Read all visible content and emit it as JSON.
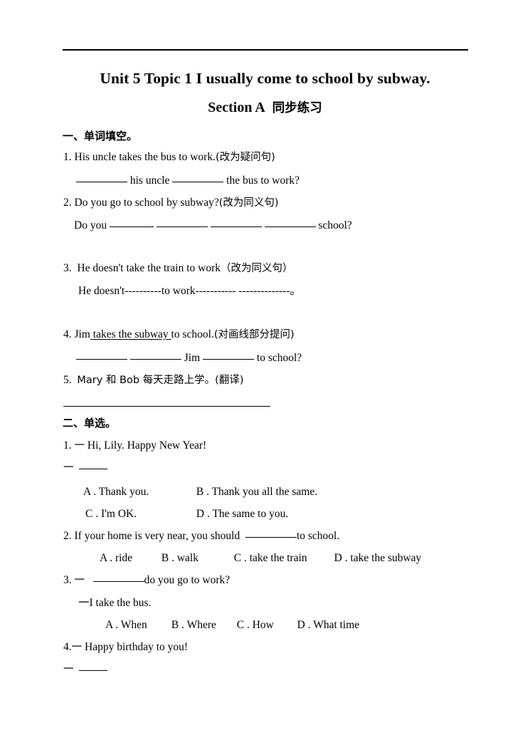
{
  "document": {
    "title": "Unit 5 Topic 1 I usually come to school by subway.",
    "subtitle_en": "Section A",
    "subtitle_cn": "同步练习"
  },
  "section_one": {
    "heading": "一、单词填空。",
    "questions": [
      {
        "number": "1.",
        "prompt": "His uncle takes the bus to work.",
        "instruction": "(改为疑问句)",
        "answer_pre": "",
        "answer_mid": "his uncle",
        "answer_post": "the bus to work?"
      },
      {
        "number": "2.",
        "prompt": "Do you go to school by subway?",
        "instruction": "(改为同义句)",
        "answer_pre": "Do you",
        "answer_post": "school?"
      },
      {
        "number": "3.",
        "prompt": "He doesn't take the train to work",
        "instruction": "（改为同义句）",
        "answer_text": "He doesn't----------to work-----------  --------------。"
      },
      {
        "number": "4.",
        "prompt_pre": "Jim",
        "prompt_underlined": " takes the subway ",
        "prompt_post": "to school.",
        "instruction": "(对画线部分提问)",
        "answer_mid": "Jim",
        "answer_post": "to school?"
      },
      {
        "number": "5.",
        "prompt": "Mary 和 Bob 每天走路上学。",
        "instruction": "(翻译)"
      }
    ]
  },
  "section_two": {
    "heading": "二、单选。",
    "questions": [
      {
        "number": "1.",
        "dash": "一",
        "stem": "Hi, Lily. Happy New Year!",
        "reply_dash": "一",
        "options": [
          {
            "letter": "A",
            "sep": ".",
            "text": "Thank you."
          },
          {
            "letter": "B",
            "sep": ".",
            "text": "Thank you all the same."
          },
          {
            "letter": "C",
            "sep": ".",
            "text": "I'm OK."
          },
          {
            "letter": "D",
            "sep": ".",
            "text": "The same to you."
          }
        ]
      },
      {
        "number": "2.",
        "stem_pre": "If your home is very near, you should",
        "stem_post": "to school.",
        "options": [
          {
            "letter": "A",
            "sep": ".",
            "text": "ride"
          },
          {
            "letter": "B",
            "sep": ".",
            "text": "walk"
          },
          {
            "letter": "C",
            "sep": ".",
            "text": "take the train"
          },
          {
            "letter": "D",
            "sep": ".",
            "text": "take the subway"
          }
        ]
      },
      {
        "number": "3.",
        "dash": "一",
        "stem_post": "do you go to work?",
        "reply": "一I take the bus.",
        "options": [
          {
            "letter": "A",
            "sep": ".",
            "text": "When"
          },
          {
            "letter": "B",
            "sep": ".",
            "text": "Where"
          },
          {
            "letter": "C",
            "sep": ".",
            "text": "How"
          },
          {
            "letter": "D",
            "sep": ".",
            "text": "What time"
          }
        ]
      },
      {
        "number": "4.",
        "dash": "一",
        "stem": "Happy birthday to you!",
        "reply_dash": "一"
      }
    ]
  }
}
